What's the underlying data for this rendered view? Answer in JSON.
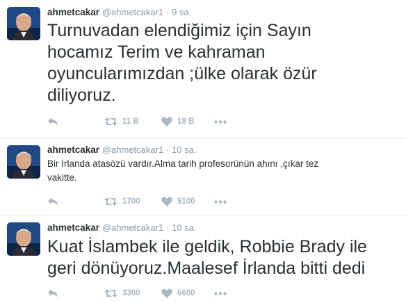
{
  "colors": {
    "text": "#292f33",
    "muted": "#8899a6",
    "action": "#aab8c2",
    "divider": "#e1e8ed"
  },
  "tweets": [
    {
      "name": "ahmetcakar",
      "handle": "@ahmetcakar1",
      "separator": "·",
      "time": "9 sa.",
      "text": "Turnuvadan elendiğimiz için Sayın\nhocamız Terim ve kahraman\noyuncularımızdan ;ülke olarak özür\ndiliyoruz.",
      "retweets": "11 B",
      "likes": "18 B",
      "icons": [
        "reply-icon",
        "retweet-icon",
        "heart-icon",
        "more-icon"
      ]
    },
    {
      "name": "ahmetcakar",
      "handle": "@ahmetcakar1",
      "separator": "·",
      "time": "10 sa.",
      "text": "Bir İrlanda atasözü vardır.Alma tarih profesorünün ahını ,çıkar tez\nvakitte.",
      "retweets": "1700",
      "likes": "5100",
      "icons": [
        "reply-icon",
        "retweet-icon",
        "heart-icon",
        "more-icon"
      ]
    },
    {
      "name": "ahmetcakar",
      "handle": "@ahmetcakar1",
      "separator": "·",
      "time": "10 sa.",
      "text": "Kuat İslambek ile geldik, Robbie Brady ile\ngeri dönüyoruz.Maalesef İrlanda bitti dedi",
      "retweets": "3300",
      "likes": "6600",
      "icons": [
        "reply-icon",
        "retweet-icon",
        "heart-icon",
        "more-icon"
      ]
    }
  ]
}
